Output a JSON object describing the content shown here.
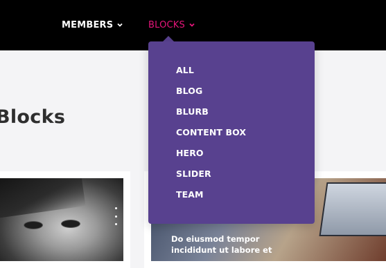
{
  "nav": {
    "members_label": "MEMBERS",
    "blocks_label": "BLOCKS"
  },
  "page": {
    "title": "Blocks"
  },
  "dropdown": {
    "items": [
      "ALL",
      "BLOG",
      "BLURB",
      "CONTENT BOX",
      "HERO",
      "SLIDER",
      "TEAM"
    ]
  },
  "post": {
    "title": "Do eiusmod tempor incididunt ut labore et"
  },
  "colors": {
    "topbar": "#000000",
    "accent_pink": "#e6157a",
    "dropdown_bg": "#58418f",
    "page_bg": "#f4f4f6"
  }
}
